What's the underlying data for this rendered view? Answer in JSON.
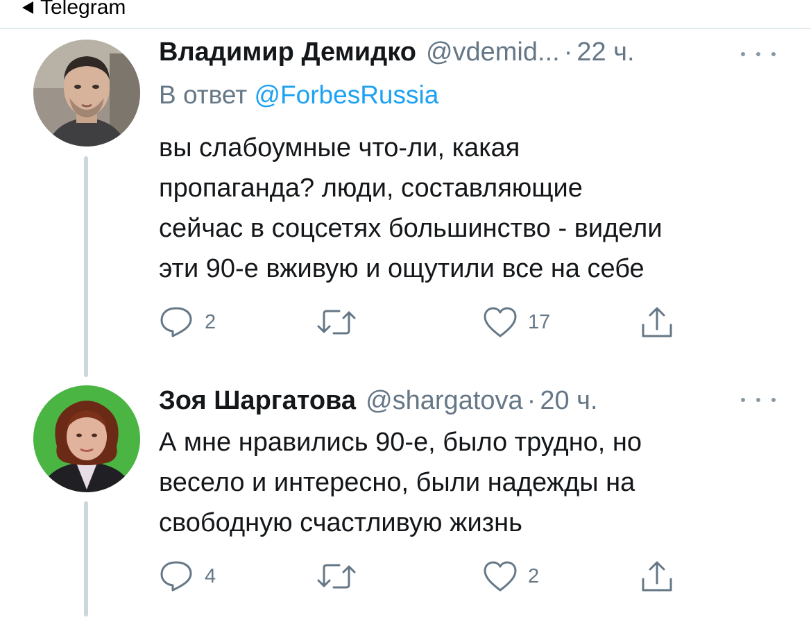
{
  "statusbar": {
    "back_label": "Telegram"
  },
  "tweets": [
    {
      "name": "Владимир Демидко",
      "handle": "@vdemid...",
      "separator": "·",
      "time": "22 ч.",
      "reply_prefix": "В ответ",
      "reply_mention": "@ForbesRussia",
      "text_lines": [
        "вы слабоумные что-ли, какая",
        "пропаганда? люди, составляющие",
        "сейчас в соцсетях большинство - видели",
        "эти 90-е вживую и ощутили все на себе"
      ],
      "replies": "2",
      "retweets": "",
      "likes": "17"
    },
    {
      "name": "Зоя Шаргатова",
      "handle": "@shargatova",
      "separator": "·",
      "time": "20 ч.",
      "text_lines": [
        "А мне нравились 90-е, было трудно, но",
        "весело и интересно, были надежды на",
        "свободную счастливую жизнь"
      ],
      "replies": "4",
      "retweets": "",
      "likes": "2"
    }
  ],
  "icons": {
    "reply": "reply-icon",
    "retweet": "retweet-icon",
    "like": "heart-icon",
    "share": "share-icon",
    "more": "more-options-icon",
    "back": "back-arrow-icon"
  },
  "colors": {
    "text": "#14171a",
    "secondary": "#657786",
    "mention": "#1da1f2",
    "thread_line": "#ccd6dd",
    "divider": "#e1e8ed"
  }
}
